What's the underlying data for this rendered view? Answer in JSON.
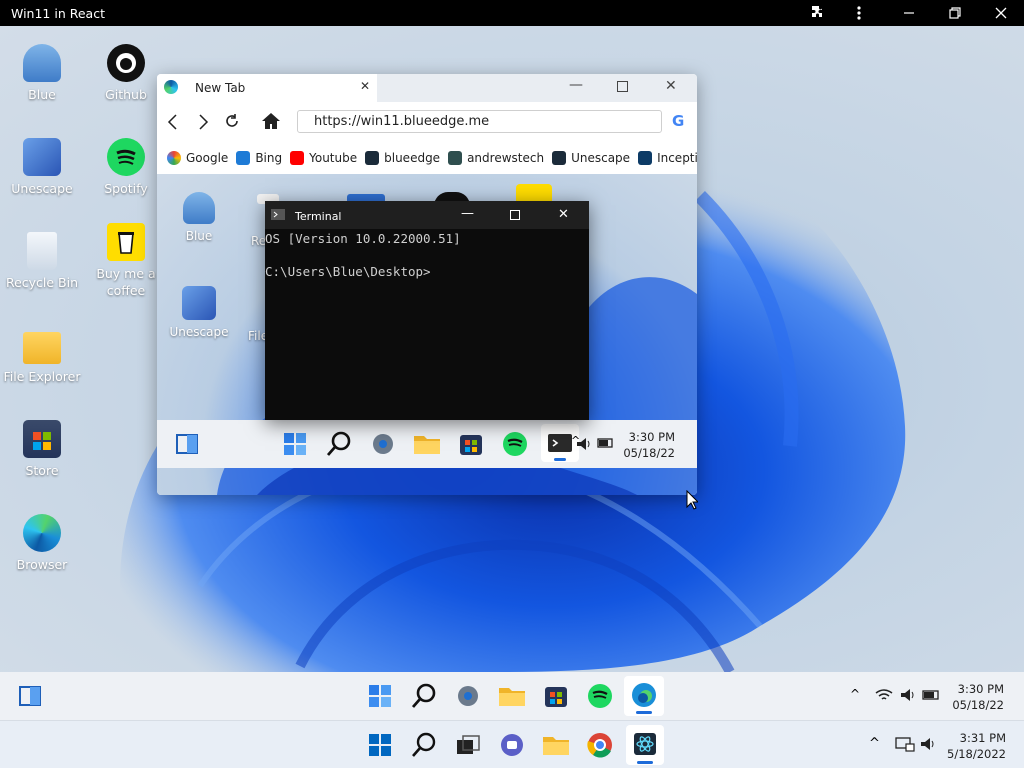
{
  "shell": {
    "title": "Win11 in React",
    "icons": [
      "puzzle-icon",
      "more-icon",
      "minimize-icon",
      "restore-icon",
      "close-icon"
    ]
  },
  "desktop": {
    "icons": [
      {
        "label": "Blue"
      },
      {
        "label": "Github"
      },
      {
        "label": "Unescape"
      },
      {
        "label": "Spotify"
      },
      {
        "label": "Recycle Bin"
      },
      {
        "label": "Buy me a coffee"
      },
      {
        "label": "File Explorer"
      },
      {
        "label": "Store"
      },
      {
        "label": "Browser"
      }
    ]
  },
  "edge": {
    "tab_title": "New Tab",
    "url": "https://win11.blueedge.me",
    "bookmarks": [
      "Google",
      "Bing",
      "Youtube",
      "blueedge",
      "andrewstech",
      "Unescape",
      "Inception"
    ],
    "inner_icons": {
      "blue": "Blue",
      "unescape": "Unescape",
      "partial_a": "Re",
      "partial_b": "File"
    },
    "inner_clock": {
      "time": "3:30 PM",
      "date": "05/18/22"
    }
  },
  "terminal": {
    "title": "Terminal",
    "line1": "OS [Version 10.0.22000.51]",
    "line2": "C:\\Users\\Blue\\Desktop>"
  },
  "taskbar": {
    "clock": {
      "time": "3:30 PM",
      "date": "05/18/22"
    }
  },
  "host_taskbar": {
    "clock": {
      "time": "3:31 PM",
      "date": "5/18/2022"
    }
  },
  "colors": {
    "accent": "#1d6bd9",
    "spotify": "#1ed760",
    "youtube": "#ff0000"
  }
}
